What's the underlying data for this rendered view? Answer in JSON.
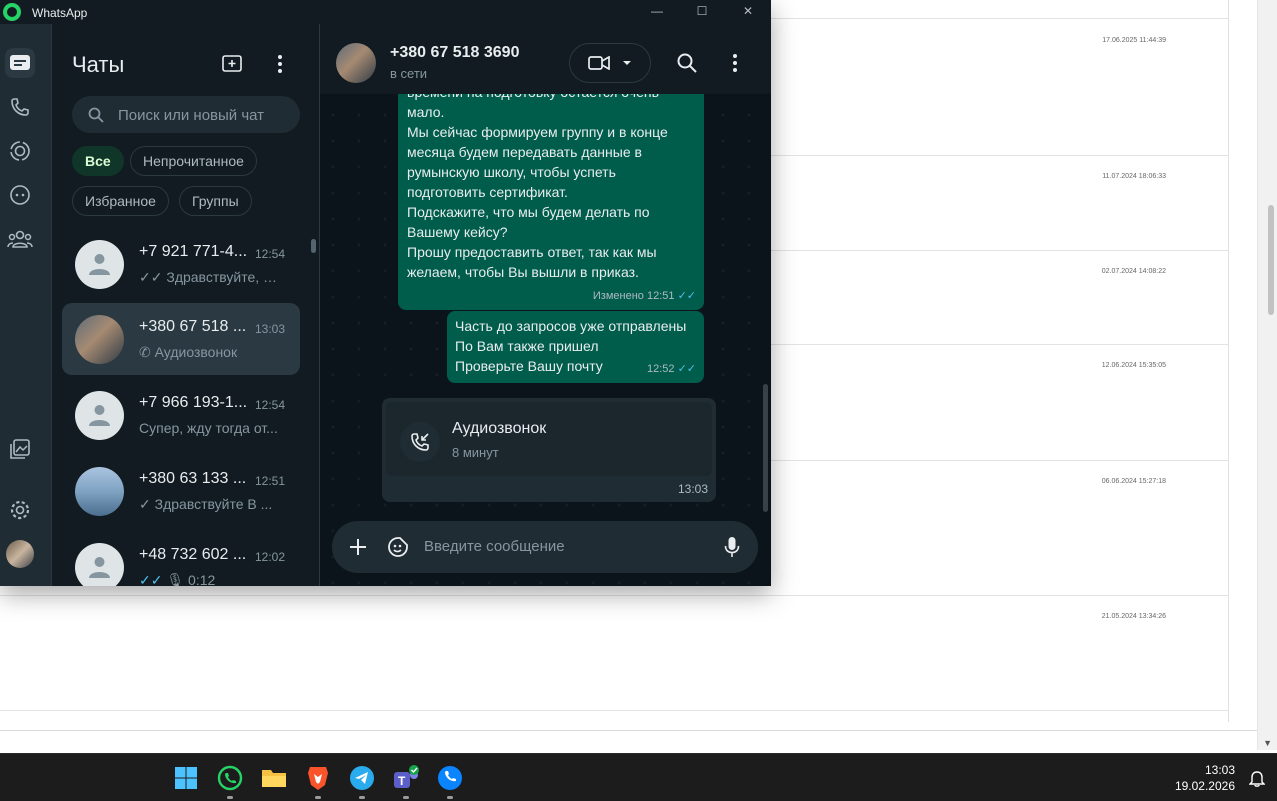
{
  "background_app": {
    "dates": [
      "17.06.2025 11:44:39",
      "11.07.2024 18:06:33",
      "02.07.2024 14:08:22",
      "12.06.2024 15:35:05",
      "06.06.2024 15:27:18",
      "21.05.2024 13:34:26"
    ]
  },
  "window": {
    "title": "WhatsApp"
  },
  "chatlist": {
    "title": "Чаты",
    "search_placeholder": "Поиск или новый чат",
    "filters": [
      "Все",
      "Непрочитанное",
      "Избранное",
      "Группы"
    ],
    "chats": [
      {
        "name": "+7 921 771-4...",
        "time": "12:54",
        "preview": "Здравствуйте, О...",
        "status": "double-check-icon"
      },
      {
        "name": "+380 67 518 ...",
        "time": "13:03",
        "preview": "Аудиозвонок",
        "status": "incoming-call-icon"
      },
      {
        "name": "+7 966 193-1...",
        "time": "12:54",
        "preview": "Супер, жду тогда от..."
      },
      {
        "name": "+380 63 133 ...",
        "time": "12:51",
        "preview": "Здравствуйте В ...",
        "status": "check-icon"
      },
      {
        "name": "+48 732 602 ...",
        "time": "12:02",
        "preview": "0:12",
        "status": "double-check-blue-icon"
      }
    ]
  },
  "conversation": {
    "contact_name": "+380 67 518 3690",
    "contact_status": "в сети",
    "messages": [
      {
        "lines": [
          "времени на подготовку остается очень",
          "мало.",
          "Мы сейчас формируем группу и в конце",
          "месяца будем передавать данные в",
          "румынскую школу, чтобы успеть",
          "подготовить сертификат.",
          "Подскажите, что мы будем делать по",
          "Вашему кейсу?",
          "Прошу предоставить ответ, так как мы",
          "желаем, чтобы Вы вышли в приказ."
        ],
        "meta": "Изменено 12:51"
      },
      {
        "lines": [
          "Часть до запросов уже отправлены",
          "По Вам также пришел",
          "Проверьте Вашу почту"
        ],
        "meta": "12:52"
      }
    ],
    "call": {
      "title": "Аудиозвонок",
      "duration": "8 минут",
      "time": "13:03"
    },
    "composer_placeholder": "Введите сообщение"
  },
  "taskbar": {
    "apps": [
      "windows-start",
      "whatsapp",
      "file-explorer",
      "brave",
      "telegram",
      "teams",
      "phone-link"
    ],
    "time": "13:03",
    "date": "19.02.2026"
  },
  "colors": {
    "accent": "#00a884",
    "outgoing_bubble": "#005c4b",
    "panel": "#111b21",
    "read_tick": "#53bdeb"
  }
}
